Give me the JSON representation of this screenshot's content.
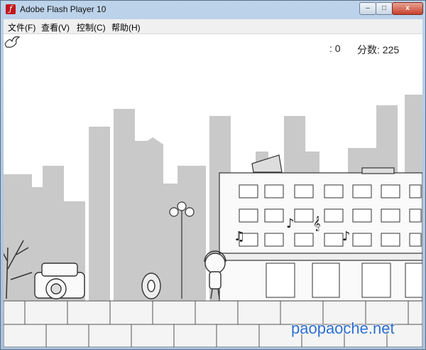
{
  "window": {
    "title": "Adobe Flash Player 10",
    "app_icon": "flash-icon",
    "controls": {
      "minimize": "–",
      "maximize": "□",
      "close": "x"
    }
  },
  "menu": {
    "items": [
      "文件(F)",
      "查看(V)",
      "控制(C)",
      "帮助(H)"
    ]
  },
  "hud": {
    "lives_icon": "dove-icon",
    "lives_text": ": 0",
    "score_text": "分数: 225"
  },
  "watermark": "paopaoche.net",
  "colors": {
    "sky": "#ffffff",
    "skyline": "#c8c8c8",
    "ink": "#333333",
    "watermark": "#2e6fd0"
  }
}
